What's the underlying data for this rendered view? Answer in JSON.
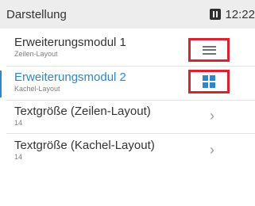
{
  "status_bar": {
    "title": "Darstellung",
    "time": "12:22",
    "icon": "device-icon"
  },
  "menu": [
    {
      "title": "Erweiterungsmodul 1",
      "subtitle": "Zeilen-Layout",
      "layout_icon": "rows-layout-icon",
      "selected": false
    },
    {
      "title": "Erweiterungsmodul 2",
      "subtitle": "Kachel-Layout",
      "layout_icon": "tiles-layout-icon",
      "selected": true
    },
    {
      "title": "Textgröße (Zeilen-Layout)",
      "subtitle": "14",
      "icon": "chevron-right-icon"
    },
    {
      "title": "Textgröße (Kachel-Layout)",
      "subtitle": "14",
      "icon": "chevron-right-icon"
    }
  ],
  "colors": {
    "accent": "#2f86c8",
    "highlight_box": "#d9232e",
    "status_bar_bg": "#ededed"
  }
}
